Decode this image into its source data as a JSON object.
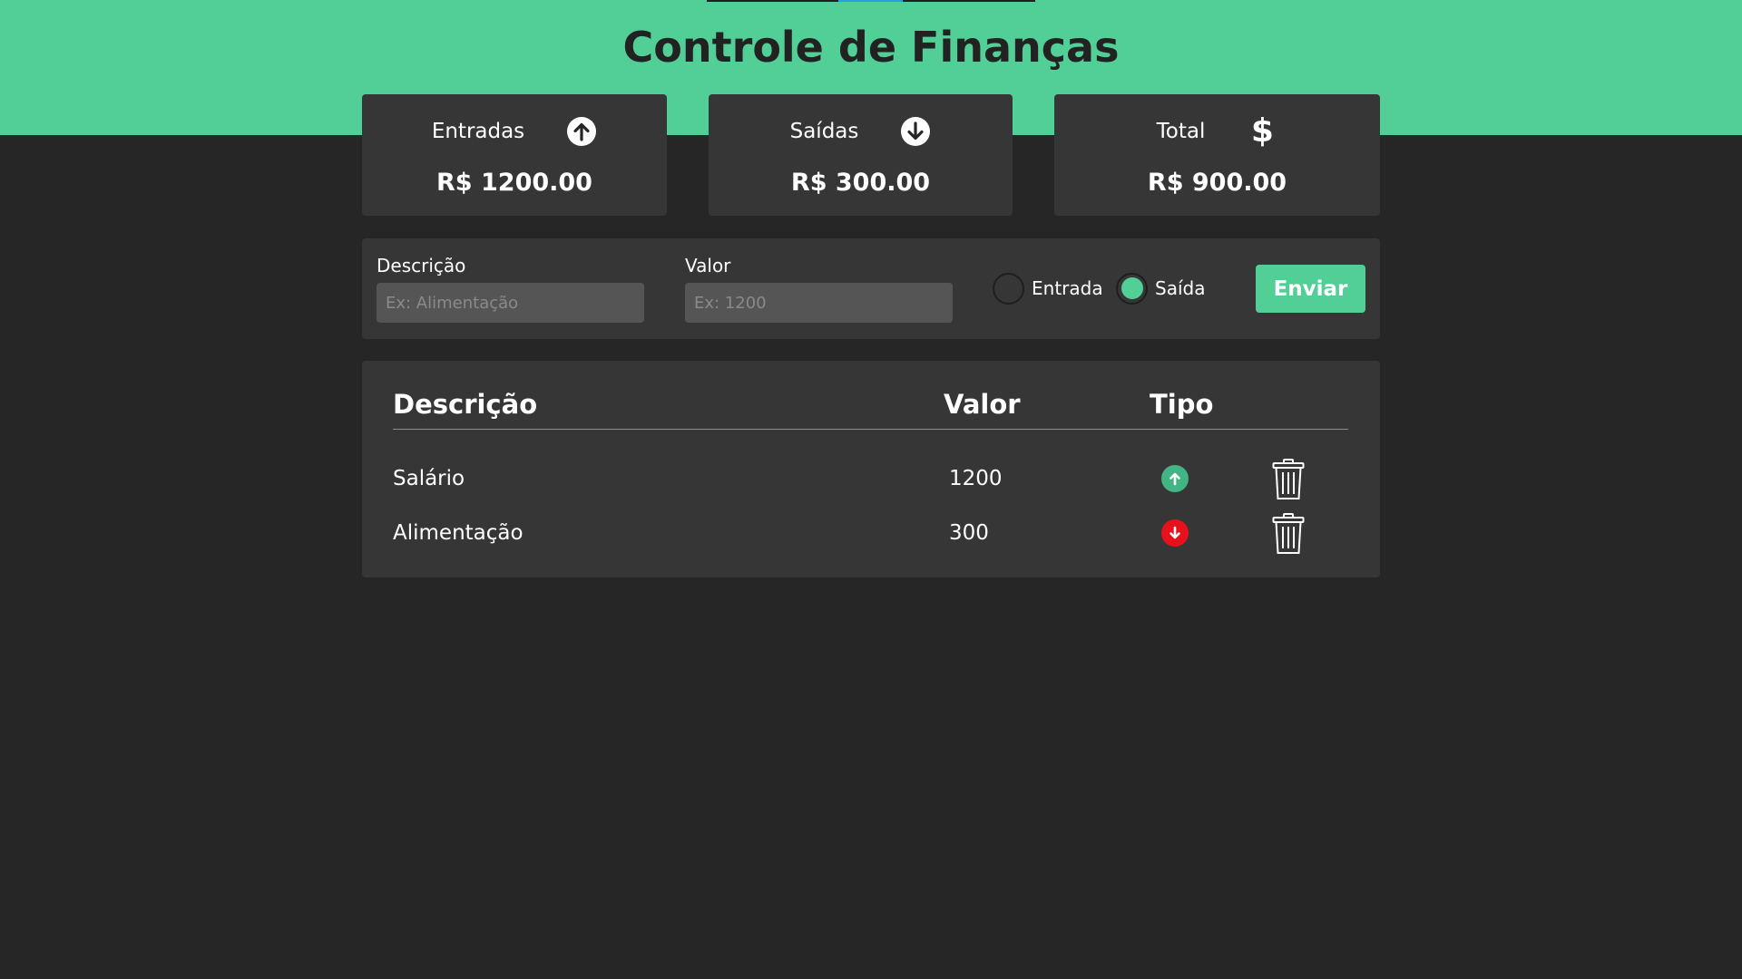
{
  "header": {
    "title": "Controle de Finanças"
  },
  "summary": {
    "income": {
      "label": "Entradas",
      "value": "R$ 1200.00",
      "icon": "arrow-up-circle-icon"
    },
    "expense": {
      "label": "Saídas",
      "value": "R$ 300.00",
      "icon": "arrow-down-circle-icon"
    },
    "total": {
      "label": "Total",
      "value": "R$ 900.00",
      "icon": "dollar-icon",
      "glyph": "$"
    }
  },
  "form": {
    "description_label": "Descrição",
    "description_placeholder": "Ex: Alimentação",
    "description_value": "",
    "value_label": "Valor",
    "value_placeholder": "Ex: 1200",
    "value_value": "",
    "radio_income_label": "Entrada",
    "radio_expense_label": "Saída",
    "selected_type": "expense",
    "submit_label": "Enviar"
  },
  "table": {
    "columns": [
      "Descrição",
      "Valor",
      "Tipo"
    ],
    "rows": [
      {
        "description": "Salário",
        "value": "1200",
        "type": "income"
      },
      {
        "description": "Alimentação",
        "value": "300",
        "type": "expense"
      }
    ]
  },
  "colors": {
    "accent": "#52cf96",
    "background": "#262626",
    "panel": "#363636",
    "income": "#43b584",
    "expense": "#e8111b"
  }
}
